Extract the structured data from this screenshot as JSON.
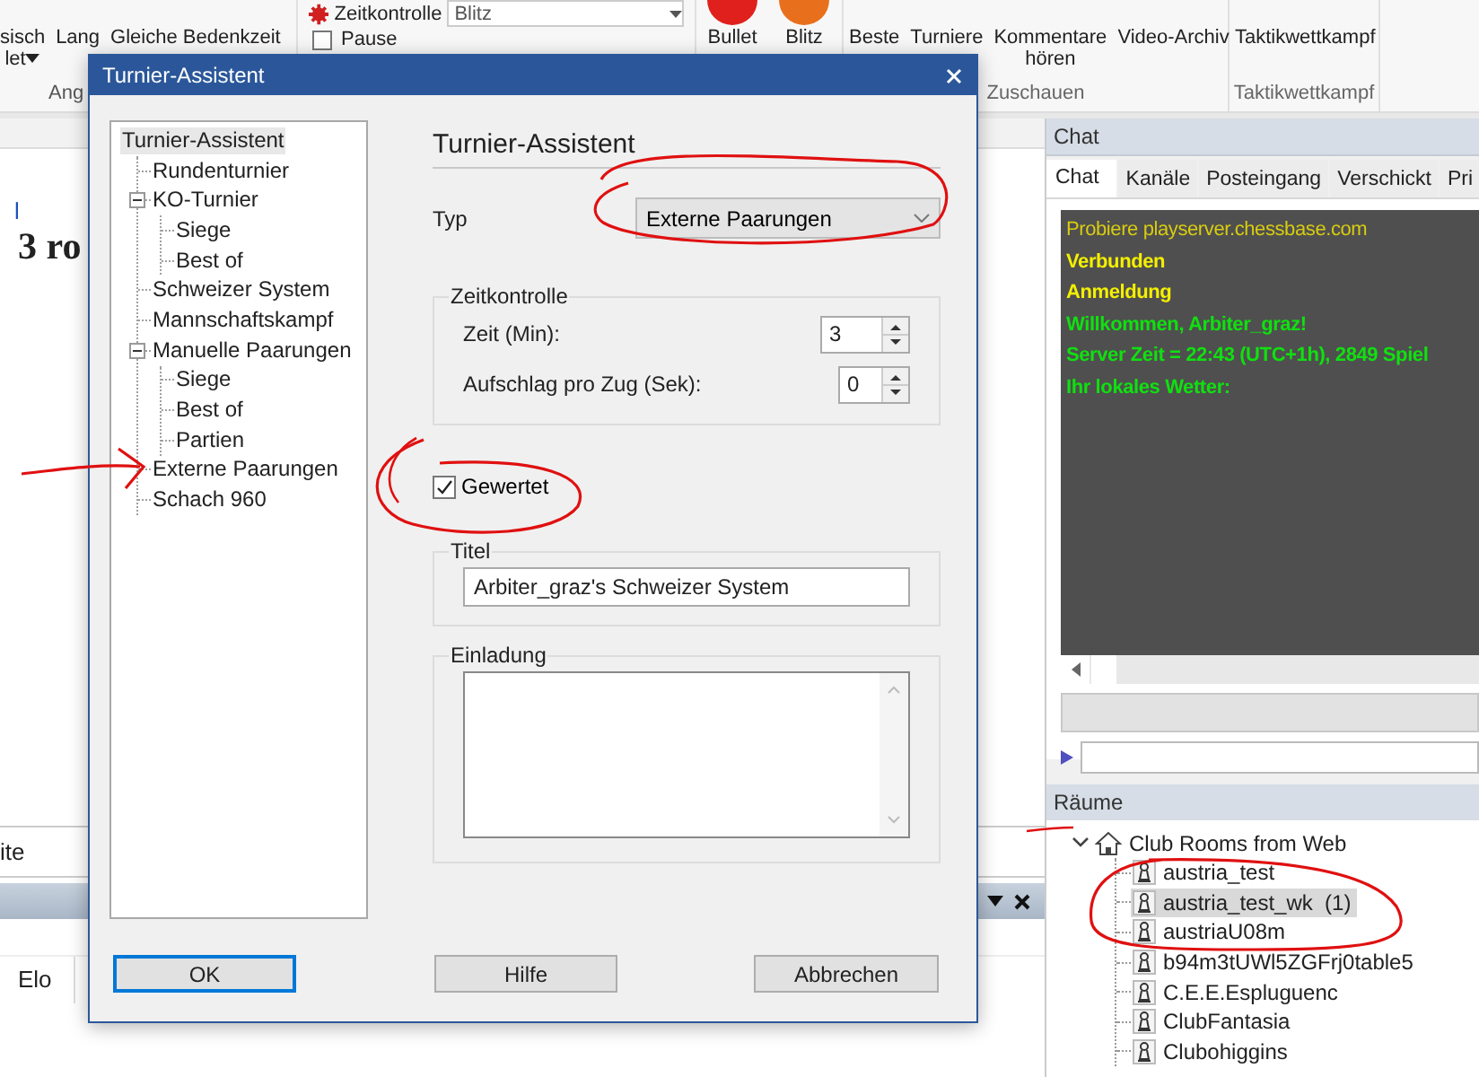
{
  "ribbon": {
    "left_group": {
      "label": "Ang",
      "buttons": [
        {
          "lines": [
            "sisch",
            "let"
          ],
          "dropdown": true
        },
        {
          "lines": [
            "Lang"
          ],
          "dropdown": false
        },
        {
          "lines": [
            "Gleiche Bedenkzeit"
          ],
          "dropdown": false
        }
      ]
    },
    "time_control": {
      "label": "Zeitkontrolle",
      "value": "Blitz"
    },
    "pause": {
      "label": "Pause",
      "checked": false
    },
    "play_buttons": [
      {
        "label": "Bullet",
        "color": "#e0201c"
      },
      {
        "label": "Blitz",
        "color": "#e8701c"
      }
    ],
    "watch_group": {
      "label": "Zuschauen",
      "buttons": [
        {
          "lines": [
            "Beste"
          ]
        },
        {
          "lines": [
            "Turniere"
          ]
        },
        {
          "lines": [
            "Kommentare",
            "hören"
          ]
        },
        {
          "lines": [
            "Video-Archiv"
          ]
        }
      ]
    },
    "tactics_group": {
      "label": "Taktikwettkampf",
      "buttons": [
        {
          "lines": [
            "Taktikwettkampf"
          ]
        }
      ]
    }
  },
  "main": {
    "link": "l",
    "heading": "3 ro",
    "field": "ite",
    "column_header": "Elo"
  },
  "chat": {
    "title": "Chat",
    "tabs": [
      {
        "label": "Chat",
        "selected": true
      },
      {
        "label": "Kanäle",
        "selected": false
      },
      {
        "label": "Posteingang",
        "selected": false
      },
      {
        "label": "Verschickt",
        "selected": false
      },
      {
        "label": "Pri",
        "selected": false
      }
    ],
    "lines": [
      {
        "text": "Probiere playserver.chessbase.com",
        "color": "#d8cc10",
        "bold": false
      },
      {
        "text": "Verbunden",
        "color": "#f4f000",
        "bold": true
      },
      {
        "text": "Anmeldung",
        "color": "#f4f000",
        "bold": true
      },
      {
        "text": "Willkommen, Arbiter_graz!",
        "color": "#10e010",
        "bold": true
      },
      {
        "text": "Server Zeit = 22:43 (UTC+1h), 2849 Spiel",
        "color": "#10e010",
        "bold": true
      },
      {
        "text": "Ihr lokales Wetter:",
        "color": "#10e010",
        "bold": true
      }
    ]
  },
  "rooms": {
    "title": "Räume",
    "root": {
      "label": "Club Rooms from Web",
      "expanded": true,
      "children": [
        {
          "label": "austria_test",
          "selected": false
        },
        {
          "label": "austria_test_wk  (1)",
          "selected": true
        },
        {
          "label": "austriaU08m",
          "selected": false
        },
        {
          "label": "b94m3tUWl5ZGFrj0table5",
          "selected": false
        },
        {
          "label": "C.E.E.Espluguenc",
          "selected": false
        },
        {
          "label": "ClubFantasia",
          "selected": false
        },
        {
          "label": "Clubohiggins",
          "selected": false
        }
      ]
    }
  },
  "dialog": {
    "title": "Turnier-Assistent",
    "tree": [
      {
        "label": "Turnier-Assistent",
        "selected": true,
        "children": [
          {
            "label": "Rundenturnier",
            "selected": false
          },
          {
            "label": "KO-Turnier",
            "selected": false,
            "expanded": true,
            "children": [
              {
                "label": "Siege",
                "selected": false
              },
              {
                "label": "Best of",
                "selected": false
              }
            ]
          },
          {
            "label": "Schweizer System",
            "selected": false
          },
          {
            "label": "Mannschaftskampf",
            "selected": false
          },
          {
            "label": "Manuelle Paarungen",
            "selected": false,
            "expanded": true,
            "children": [
              {
                "label": "Siege",
                "selected": false
              },
              {
                "label": "Best of",
                "selected": false
              },
              {
                "label": "Partien",
                "selected": false
              }
            ]
          },
          {
            "label": "Externe Paarungen",
            "selected": false
          },
          {
            "label": "Schach 960",
            "selected": false
          }
        ]
      }
    ],
    "heading": "Turnier-Assistent",
    "type": {
      "label": "Typ",
      "value": "Externe Paarungen"
    },
    "time_control": {
      "legend": "Zeitkontrolle",
      "fields": [
        {
          "label": "Zeit (Min):",
          "value": "3"
        },
        {
          "label": "Aufschlag pro Zug (Sek):",
          "value": "0"
        }
      ]
    },
    "rated": {
      "label": "Gewertet",
      "checked": true
    },
    "title_group": {
      "legend": "Titel",
      "value": "Arbiter_graz's Schweizer System"
    },
    "invitation": {
      "legend": "Einladung"
    },
    "buttons": [
      {
        "label": "OK",
        "default": true
      },
      {
        "label": "Hilfe",
        "default": false
      },
      {
        "label": "Abbrechen",
        "default": false
      }
    ]
  },
  "annotations": [
    {
      "kind": "arrow"
    },
    {
      "kind": "ellipse"
    },
    {
      "kind": "ellipse"
    },
    {
      "kind": "stroke"
    },
    {
      "kind": "stroke"
    },
    {
      "kind": "ellipse"
    }
  ]
}
